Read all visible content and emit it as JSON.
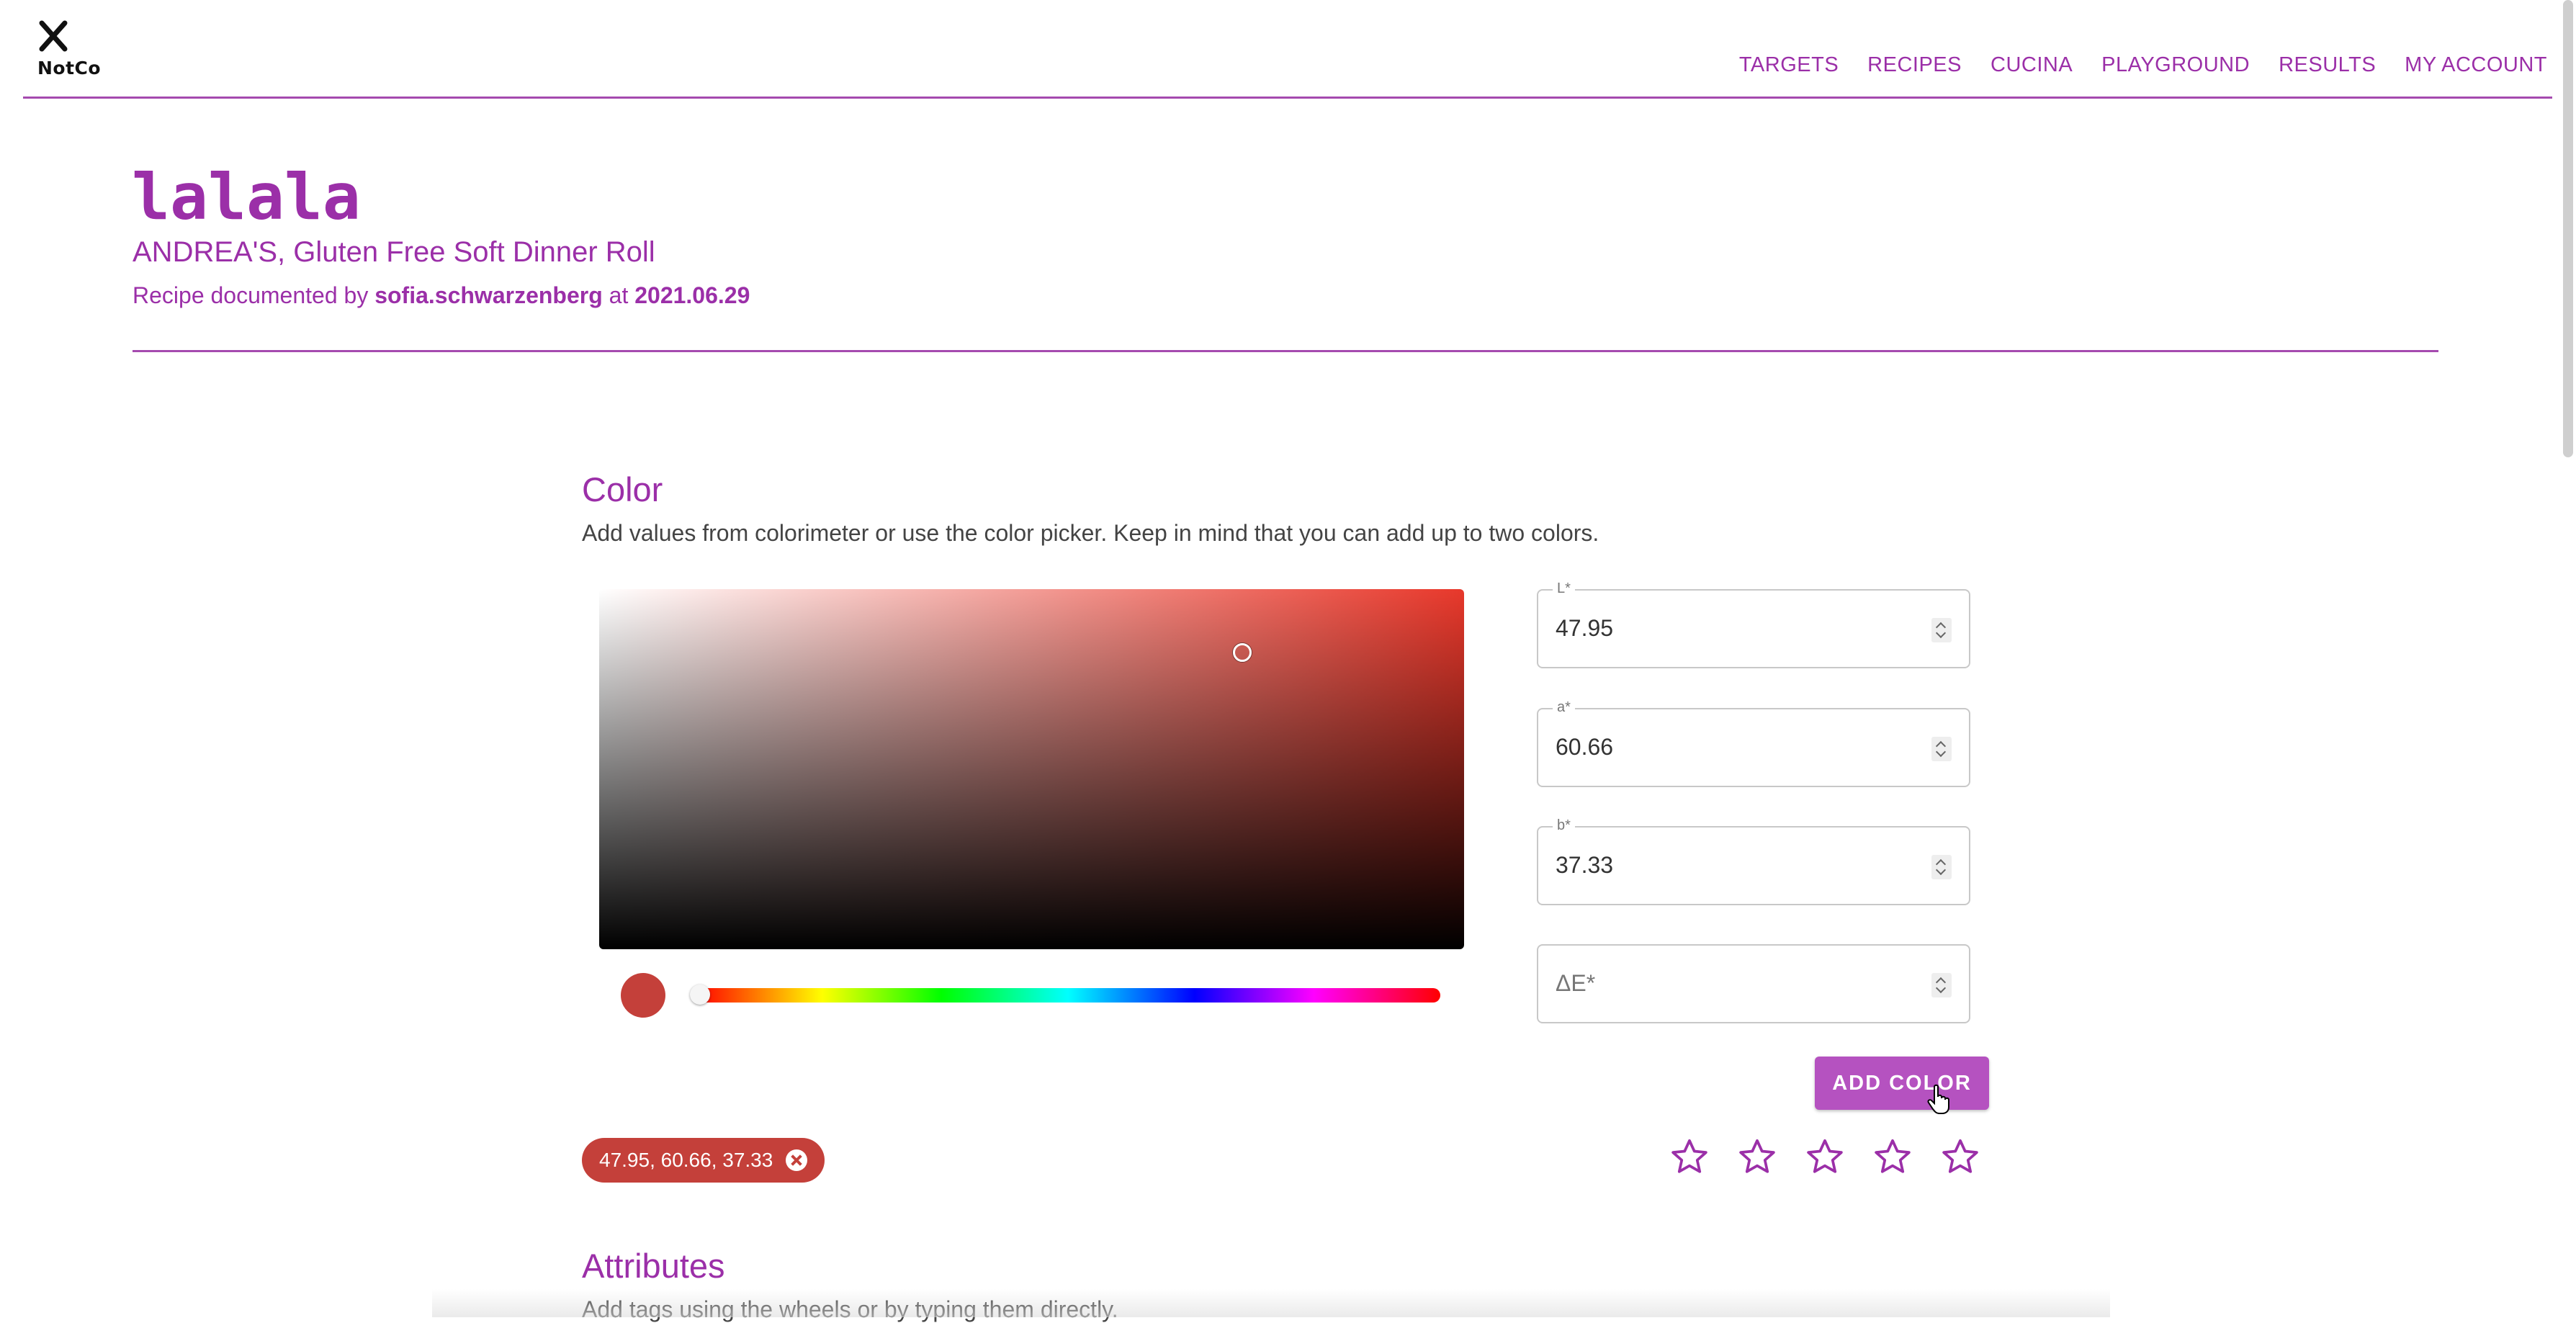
{
  "brand": {
    "logo_text": "NotCo"
  },
  "nav": {
    "items": [
      "TARGETS",
      "RECIPES",
      "CUCINA",
      "PLAYGROUND",
      "RESULTS",
      "MY ACCOUNT"
    ]
  },
  "page": {
    "title": "lalala",
    "subtitle": "ANDREA'S, Gluten Free Soft Dinner Roll",
    "byline_prefix": "Recipe documented by",
    "author": "sofia.schwarzenberg",
    "byline_mid": "at",
    "date": "2021.06.29"
  },
  "color_section": {
    "title": "Color",
    "description": "Add values from colorimeter or use the color picker. Keep in mind that you can add up to two colors.",
    "swatch_color": "#c4403a",
    "fields": {
      "L": {
        "label": "L*",
        "value": "47.95"
      },
      "a": {
        "label": "a*",
        "value": "60.66"
      },
      "b": {
        "label": "b*",
        "value": "37.33"
      },
      "dE": {
        "placeholder": "ΔE*",
        "value": ""
      }
    },
    "add_button": "ADD COLOR",
    "chip_label": "47.95, 60.66, 37.33",
    "rating": {
      "max": 5,
      "value": 0
    }
  },
  "attributes_section": {
    "title": "Attributes",
    "description": "Add tags using the wheels or by typing them directly."
  },
  "colors": {
    "accent": "#9b2fa8",
    "button": "#b552c0",
    "chip": "#c4403a"
  }
}
